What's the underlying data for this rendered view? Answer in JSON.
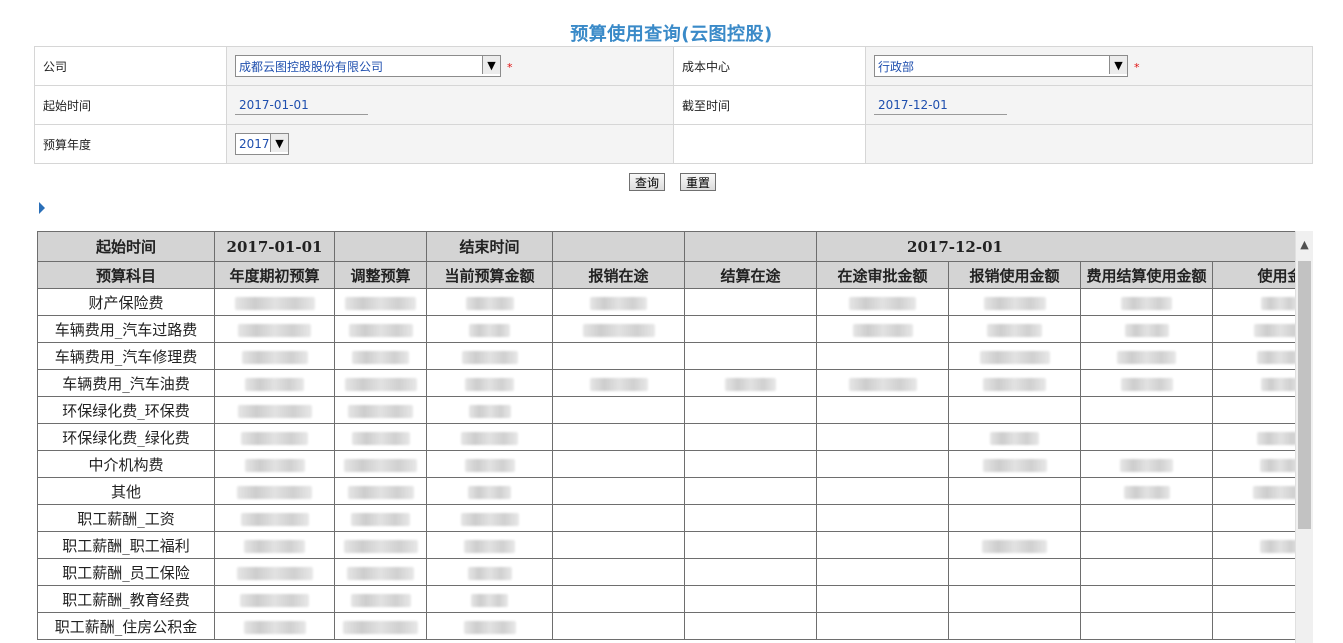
{
  "page_title": "预算使用查询(云图控股)",
  "form": {
    "company_label": "公司",
    "company_value": "成都云图控股股份有限公司",
    "cost_center_label": "成本中心",
    "cost_center_value": "行政部",
    "start_label": "起始时间",
    "start_value": "2017-01-01",
    "end_label": "截至时间",
    "end_value": "2017-12-01",
    "year_label": "预算年度",
    "year_value": "2017",
    "required_mark": "*"
  },
  "buttons": {
    "query": "查询",
    "reset": "重置"
  },
  "grid": {
    "top_row": {
      "start_label": "起始时间",
      "start_value": "2017-01-01",
      "end_label": "结束时间",
      "end_value": "2017-12-01"
    },
    "columns": [
      "预算科目",
      "年度期初预算",
      "调整预算",
      "当前预算金额",
      "报销在途",
      "结算在途",
      "在途审批金额",
      "报销使用金额",
      "费用结算使用金额",
      "使用金"
    ],
    "rows": [
      "财产保险费",
      "车辆费用_汽车过路费",
      "车辆费用_汽车修理费",
      "车辆费用_汽车油费",
      "环保绿化费_环保费",
      "环保绿化费_绿化费",
      "中介机构费",
      "其他",
      "职工薪酬_工资",
      "职工薪酬_职工福利",
      "职工薪酬_员工保险",
      "职工薪酬_教育经费",
      "职工薪酬_住房公积金"
    ]
  },
  "icons": {
    "dropdown": "chevron-down-icon",
    "expand": "triangle-right-icon",
    "scroll_up": "chevron-up-icon"
  }
}
